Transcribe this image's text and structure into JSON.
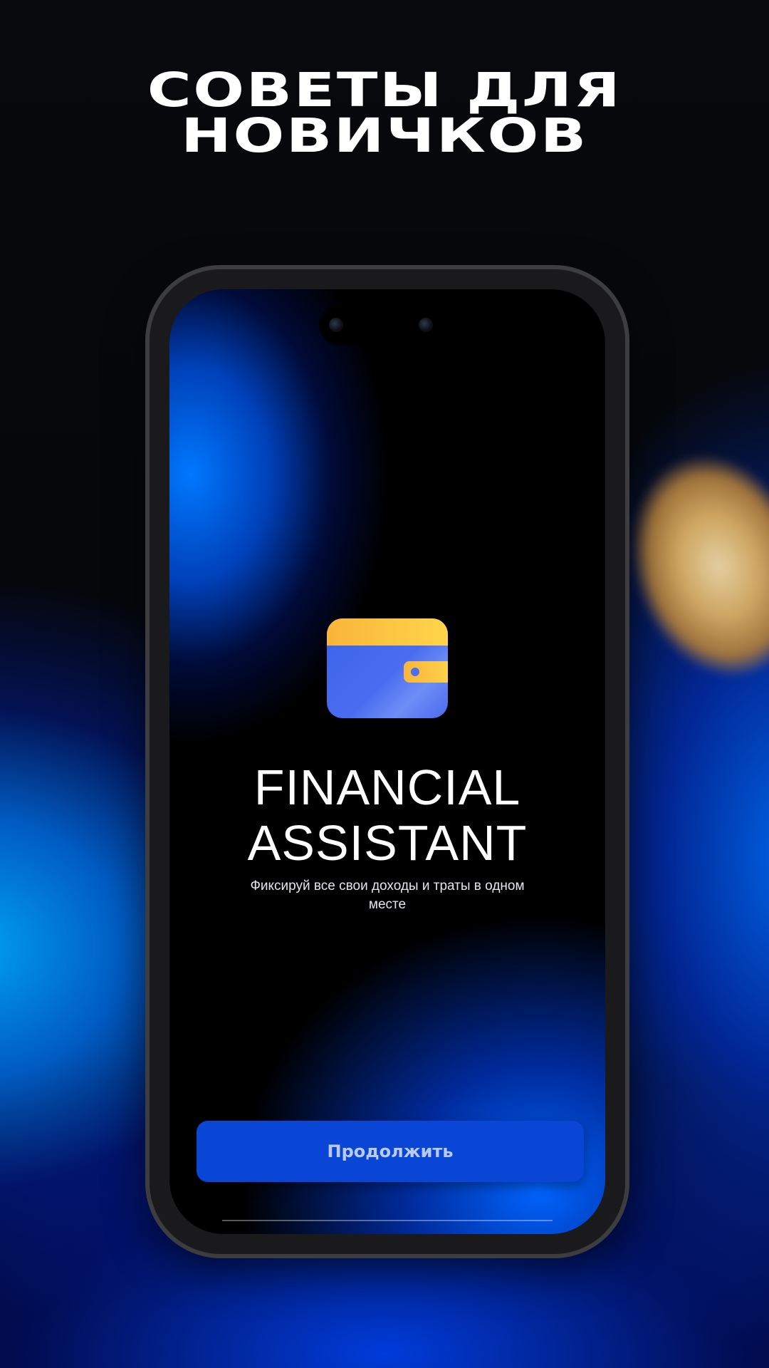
{
  "promo": {
    "headline_line1": "СОВЕТЫ ДЛЯ",
    "headline_line2": "НОВИЧКОВ"
  },
  "app": {
    "logo_icon": "wallet-icon",
    "title_line1": "FINANCIAL",
    "title_line2": "ASSISTANT",
    "subtitle": "Фиксируй все свои доходы и траты в одном месте",
    "continue_label": "Продолжить"
  },
  "colors": {
    "accent_blue": "#0a46d6",
    "wallet_blue": "#3b63e8",
    "wallet_yellow": "#ffd54a",
    "background": "#000000"
  }
}
